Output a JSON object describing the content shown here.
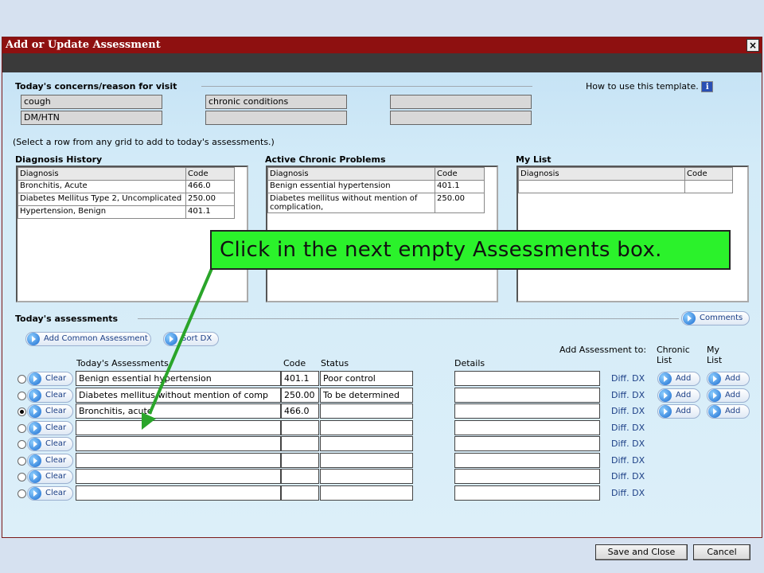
{
  "window": {
    "title": "Add or Update Assessment",
    "close_glyph": "×"
  },
  "concerns": {
    "title": "Today's concerns/reason for visit",
    "help_text": "How to use this template.",
    "fields": [
      "cough",
      "chronic conditions",
      "",
      "DM/HTN",
      "",
      ""
    ]
  },
  "instruction": "(Select a row from any grid to add to today's assessments.)",
  "grids": {
    "diagnosis_history": {
      "title": "Diagnosis History",
      "headers": [
        "Diagnosis",
        "Code"
      ],
      "rows": [
        [
          "Bronchitis, Acute",
          "466.0"
        ],
        [
          "Diabetes Mellitus Type 2, Uncomplicated",
          "250.00"
        ],
        [
          "Hypertension, Benign",
          "401.1"
        ]
      ]
    },
    "active_chronic": {
      "title": "Active Chronic Problems",
      "headers": [
        "Diagnosis",
        "Code"
      ],
      "rows": [
        [
          "Benign essential hypertension",
          "401.1"
        ],
        [
          "Diabetes mellitus without mention of complication,",
          "250.00"
        ]
      ]
    },
    "my_list": {
      "title": "My List",
      "headers": [
        "Diagnosis",
        "Code"
      ]
    }
  },
  "assessments": {
    "title": "Today's assessments",
    "comments_label": "Comments",
    "add_common_label": "Add Common Assessment",
    "sort_dx_label": "Sort DX",
    "col_assessments": "Today's Assessments",
    "col_code": "Code",
    "col_status": "Status",
    "col_details": "Details",
    "add_to_label": "Add Assessment to:",
    "chronic_list_label": "Chronic List",
    "my_list_label": "My List",
    "clear_label": "Clear",
    "diff_dx_label": "Diff. DX",
    "add_label": "Add",
    "rows": [
      {
        "assessment": "Benign essential hypertension",
        "code": "401.1",
        "status": "Poor control",
        "selected": false
      },
      {
        "assessment": "Diabetes mellitus without mention of comp",
        "code": "250.00",
        "status": "To be determined",
        "selected": false
      },
      {
        "assessment": "Bronchitis, acute",
        "code": "466.0",
        "status": "",
        "selected": true
      },
      {
        "assessment": "",
        "code": "",
        "status": "",
        "selected": false
      },
      {
        "assessment": "",
        "code": "",
        "status": "",
        "selected": false
      },
      {
        "assessment": "",
        "code": "",
        "status": "",
        "selected": false
      },
      {
        "assessment": "",
        "code": "",
        "status": "",
        "selected": false
      },
      {
        "assessment": "",
        "code": "",
        "status": "",
        "selected": false
      }
    ]
  },
  "buttons": {
    "save_close": "Save and Close",
    "cancel": "Cancel"
  },
  "callout": {
    "text": "Click in the next empty Assessments box.",
    "color": "#2bf22b",
    "arrow_color": "#2aa52a"
  }
}
